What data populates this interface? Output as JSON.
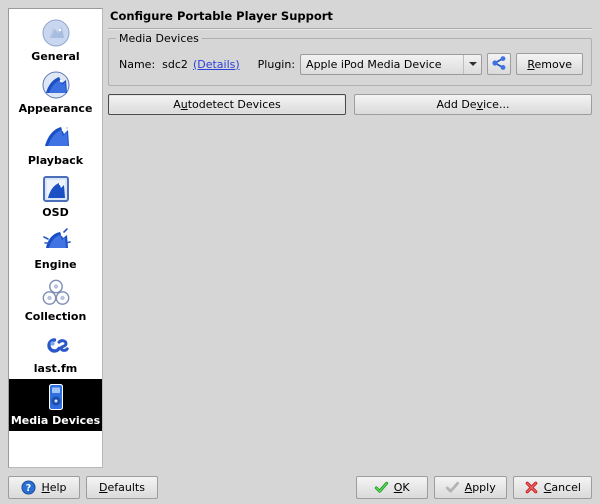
{
  "window": {
    "title": "Configure Portable Player Support"
  },
  "sidebar": {
    "items": [
      {
        "label": "General",
        "icon": "amarok-wolf-general-icon",
        "selected": false
      },
      {
        "label": "Appearance",
        "icon": "amarok-wolf-appearance-icon",
        "selected": false
      },
      {
        "label": "Playback",
        "icon": "amarok-wolf-playback-icon",
        "selected": false
      },
      {
        "label": "OSD",
        "icon": "amarok-wolf-osd-icon",
        "selected": false
      },
      {
        "label": "Engine",
        "icon": "amarok-wolf-engine-icon",
        "selected": false
      },
      {
        "label": "Collection",
        "icon": "collection-discs-icon",
        "selected": false
      },
      {
        "label": "last.fm",
        "icon": "lastfm-logo-icon",
        "selected": false
      },
      {
        "label": "Media Devices",
        "icon": "ipod-media-device-icon",
        "selected": true
      }
    ]
  },
  "media_devices_group": {
    "title": "Media Devices",
    "name_label": "Name:",
    "name_value": "sdc2",
    "details_link": "(Details)",
    "plugin_label": "Plugin:",
    "plugin_value": "Apple iPod Media Device",
    "configure_icon": "configure-plugin-icon",
    "remove_button": "Remove",
    "remove_accel": "R"
  },
  "actions": {
    "autodetect_button": "Autodetect Devices",
    "autodetect_accel": "u",
    "add_device_button": "Add Device...",
    "add_device_accel": "v"
  },
  "footer": {
    "help_button": "Help",
    "help_accel": "H",
    "help_icon": "help-question-icon",
    "defaults_button": "Defaults",
    "defaults_accel": "D",
    "ok_button": "OK",
    "ok_accel": "O",
    "ok_icon": "green-check-icon",
    "apply_button": "Apply",
    "apply_accel": "A",
    "apply_icon": "gray-check-icon",
    "cancel_button": "Cancel",
    "cancel_accel": "C",
    "cancel_icon": "red-x-icon"
  },
  "colors": {
    "background": "#d6d6d6",
    "link": "#2b41d8",
    "selection": "#000000",
    "accent_blue": "#2a58c8",
    "ok_green": "#22a322",
    "cancel_red": "#cc2b2b"
  }
}
